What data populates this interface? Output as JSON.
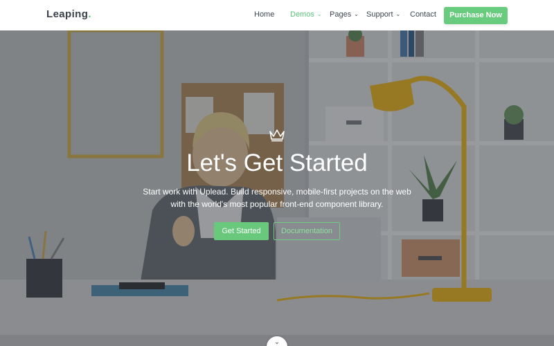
{
  "brand": {
    "name": "Leaping",
    "dot": ".",
    "accent": "#5cc57a"
  },
  "nav": {
    "items": [
      {
        "label": "Home",
        "dropdown": false,
        "active": false
      },
      {
        "label": "Demos",
        "dropdown": true,
        "active": true
      },
      {
        "label": "Pages",
        "dropdown": true,
        "active": false
      },
      {
        "label": "Support",
        "dropdown": true,
        "active": false
      },
      {
        "label": "Contact",
        "dropdown": false,
        "active": false
      }
    ],
    "caret_icon": "chevron-down-icon",
    "purchase_label": "Purchase Now"
  },
  "hero": {
    "icon": "crown-icon",
    "title": "Let's Get Started",
    "subtitle_line1": "Start work with Uplead. Build responsive, mobile-first projects on the web",
    "subtitle_line2": "with the world's most popular front-end component library.",
    "primary_button": "Get Started",
    "secondary_button": "Documentation",
    "scroll_icon": "chevron-down-icon"
  },
  "colors": {
    "primary_green": "#68c87c",
    "overlay": "#282c34",
    "nav_text": "#3d454f"
  }
}
